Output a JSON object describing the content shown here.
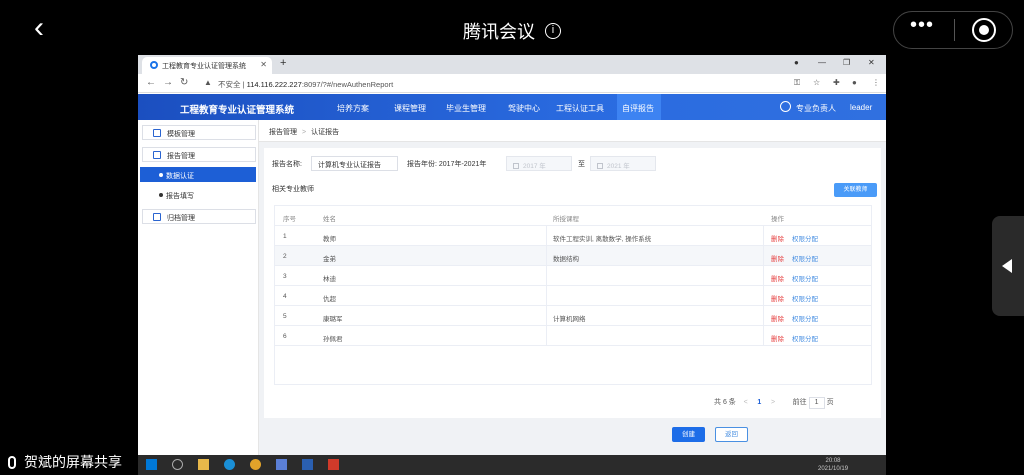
{
  "meeting": {
    "title": "腾讯会议",
    "share_label": "贺斌的屏幕共享"
  },
  "browser": {
    "tab_title": "工程教育专业认证管理系统",
    "security": "不安全",
    "url_host": "114.116.222.227",
    "url_rest": ":8097/?#/newAuthenReport"
  },
  "app": {
    "title": "工程教育专业认证管理系统",
    "nav": [
      "培养方案",
      "课程管理",
      "毕业生管理",
      "驾驶中心",
      "工程认证工具",
      "自评报告"
    ],
    "user_role": "专业负责人",
    "user_name": "leader"
  },
  "sidebar": {
    "groups": [
      {
        "label": "模板管理"
      },
      {
        "label": "报告管理"
      },
      {
        "label": "归档管理"
      }
    ],
    "subs": [
      {
        "label": "数据认证"
      },
      {
        "label": "报告填写"
      }
    ]
  },
  "breadcrumb": {
    "parent": "报告管理",
    "current": "认证报告"
  },
  "form": {
    "report_name_label": "报告名称:",
    "report_name_value": "计算机专业认证报告",
    "year_label": "报告年份: 2017年-2021年",
    "start_year": "2017 年",
    "to": "至",
    "end_year": "2021 年",
    "teachers_label": "相关专业教师",
    "assoc_button": "关联教师"
  },
  "table": {
    "headers": {
      "no": "序号",
      "name": "姓名",
      "course": "所授课程",
      "op": "操作"
    },
    "rows": [
      {
        "no": "1",
        "name": "教师",
        "course": "软件工程实训, 离散数学, 操作系统"
      },
      {
        "no": "2",
        "name": "金弟",
        "course": "数据结构"
      },
      {
        "no": "3",
        "name": "林迪",
        "course": ""
      },
      {
        "no": "4",
        "name": "仇超",
        "course": ""
      },
      {
        "no": "5",
        "name": "康璐军",
        "course": "计算机网络"
      },
      {
        "no": "6",
        "name": "孙佩君",
        "course": ""
      }
    ],
    "delete_label": "删除",
    "perm_label": "权限分配"
  },
  "pager": {
    "total": "共 6 条",
    "prev": "<",
    "page": "1",
    "next": ">",
    "goto": "前往",
    "goto_value": "1",
    "page_unit": "页"
  },
  "actions": {
    "create": "创建",
    "back": "返回"
  },
  "taskbar": {
    "time": "20:08",
    "date": "2021/10/19"
  }
}
